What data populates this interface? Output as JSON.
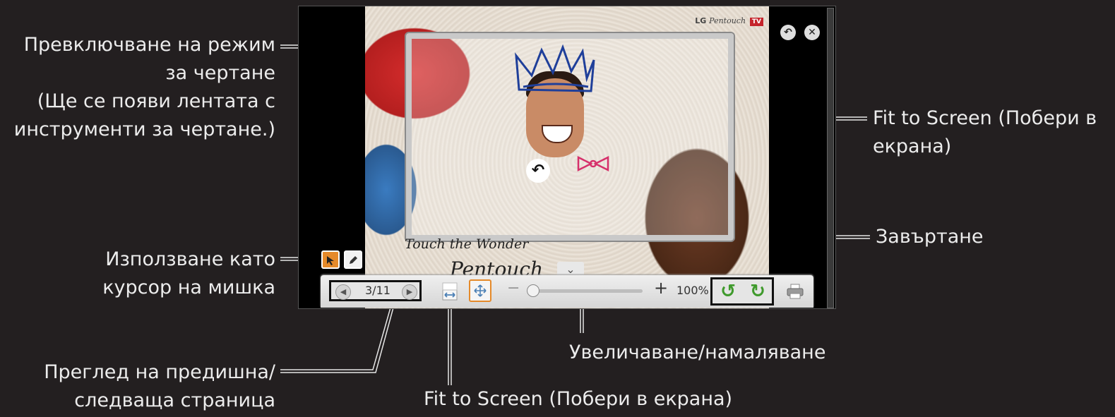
{
  "callouts": {
    "drawing_mode": [
      "Превключване на режим",
      "за чертане",
      "(Ще се появи лентата с",
      "инструменти за чертане.)"
    ],
    "mouse_cursor": [
      "Използване като",
      "курсор на мишка"
    ],
    "prev_next": [
      "Преглед на предишна/",
      "следваща страница"
    ],
    "fit_screen_top": [
      "Fit to Screen (Побери в",
      "екрана)"
    ],
    "rotate": "Завъртане",
    "zoom": "Увеличаване/намаляване",
    "fit_screen_bottom": "Fit to Screen (Побери в екрана)"
  },
  "viewer": {
    "brand": "LG",
    "brand_script": "Pentouch",
    "brand_badge": "TV",
    "photo_text_line1": "Touch the Wonder",
    "photo_text_line2": "Pentouch",
    "toolbar": {
      "page": "3/11",
      "zoom": "100%",
      "minus": "−",
      "plus": "+"
    }
  },
  "icons": {
    "prev": "◀",
    "next": "▶",
    "chevron": "⌄",
    "undo": "↶",
    "close": "✕",
    "rotate_left": "↺",
    "rotate_right": "↻"
  },
  "colors": {
    "background": "#231f20",
    "accent_orange": "#e58a2a",
    "rotate_green": "#3f9a2c",
    "brand_red": "#c5242b"
  }
}
